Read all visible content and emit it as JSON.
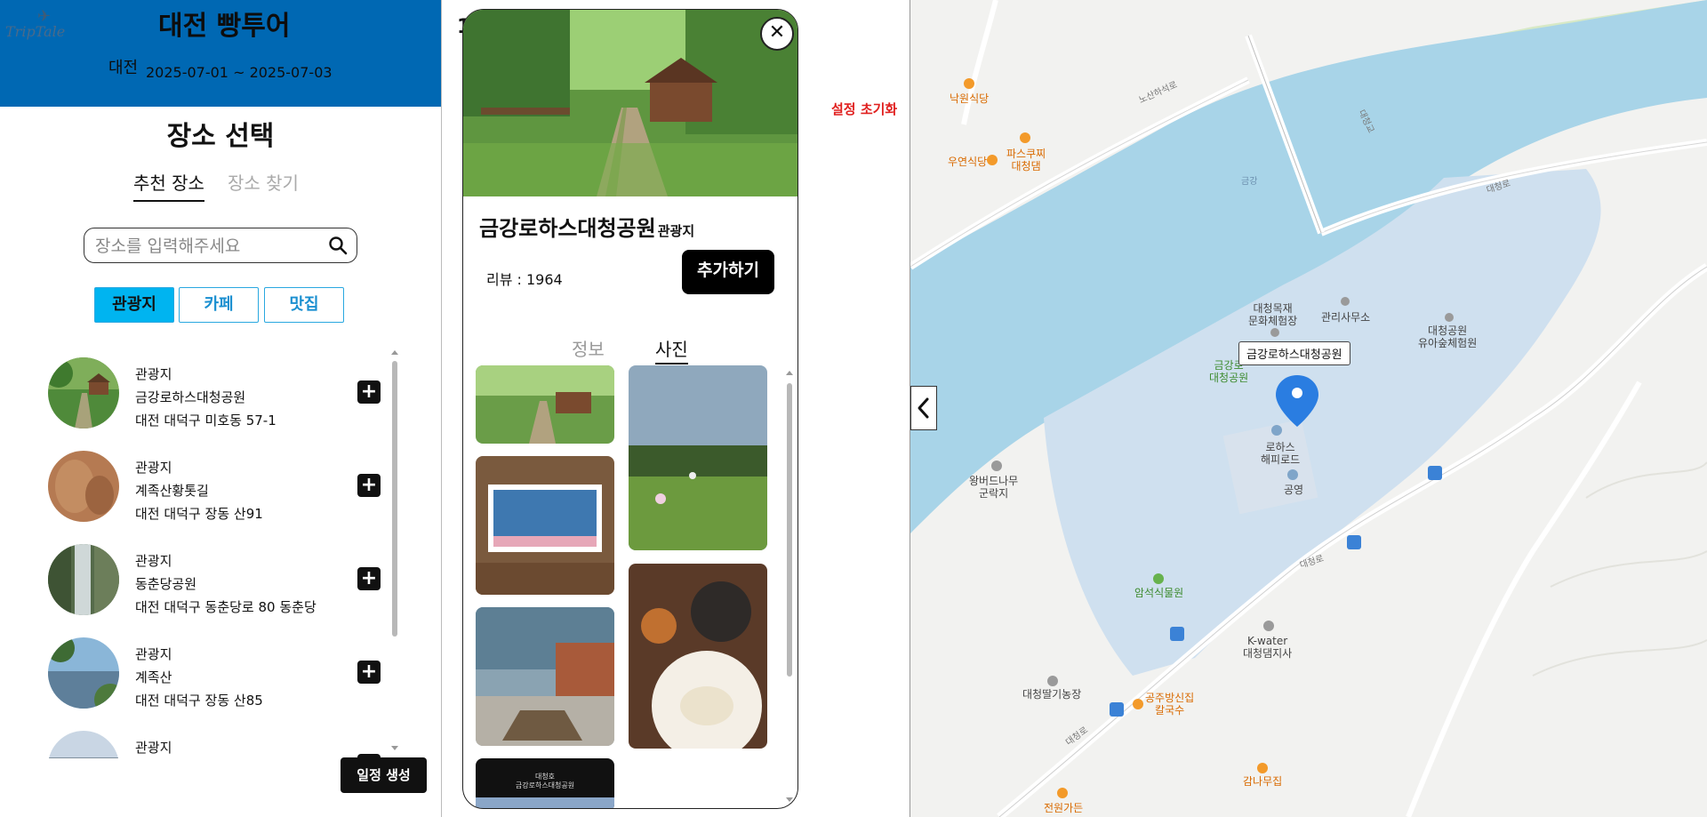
{
  "header": {
    "logo_text": "TripTale",
    "title": "대전 빵투어",
    "region": "대전",
    "dates": "2025-07-01 ~ 2025-07-03"
  },
  "place_select": {
    "title": "장소 선택",
    "tabs": [
      {
        "label": "추천 장소",
        "active": true
      },
      {
        "label": "장소 찾기",
        "active": false
      }
    ],
    "search": {
      "placeholder": "장소를 입력해주세요",
      "value": ""
    },
    "categories": [
      {
        "label": "관광지",
        "selected": true
      },
      {
        "label": "카페",
        "selected": false
      },
      {
        "label": "맛집",
        "selected": false
      }
    ],
    "places": [
      {
        "category": "관광지",
        "name": "금강로하스대청공원",
        "address": "대전 대덕구 미호동 57-1"
      },
      {
        "category": "관광지",
        "name": "계족산황톳길",
        "address": "대전 대덕구 장동 산91"
      },
      {
        "category": "관광지",
        "name": "동춘당공원",
        "address": "대전 대덕구 동춘당로 80 동춘당"
      },
      {
        "category": "관광지",
        "name": "계족산",
        "address": "대전 대덕구 장동 산85"
      },
      {
        "category": "관광지",
        "name": "",
        "address": ""
      }
    ],
    "schedule_button": "일정 생성"
  },
  "reset_label": "설정 초기화",
  "partial_digit": "1",
  "detail": {
    "name": "금강로하스대청공원",
    "category": "관광지",
    "review": "리뷰 : 1964",
    "add_button": "추가하기",
    "tabs": [
      {
        "label": "정보",
        "active": false
      },
      {
        "label": "사진",
        "active": true
      }
    ],
    "photo_sign_line1": "대청호",
    "photo_sign_line2": "금강로하스대청공원"
  },
  "map": {
    "marker_label": "금강로하스대청공원",
    "labels": {
      "nakwon": "낙원식당",
      "pasta": "파스쿠찌\n대청댐",
      "uyeon": "우연식당",
      "noksan": "노산하석로",
      "daecheonggyo": "대청교",
      "geumgang": "금강",
      "daecheongro1": "대청로",
      "mokjae": "대청목재\n문화체험장",
      "office": "관리사무소",
      "yua": "대청공원\n유아숲체험원",
      "park_green": "금강로\n대청공원",
      "lohas_road": "로하스\n해피로드",
      "parking": "공영",
      "wangbeodeul": "왕버드나무\n군락지",
      "amseok": "암석식물원",
      "daecheongro2": "대청로",
      "kwater": "K-water\n대청댐지사",
      "ttalgi": "대청딸기농장",
      "gongju": "공주방신집\n칼국수",
      "daecheongro3": "대청로",
      "gamnamu": "감나무집",
      "jeonwon": "전원가든"
    }
  }
}
